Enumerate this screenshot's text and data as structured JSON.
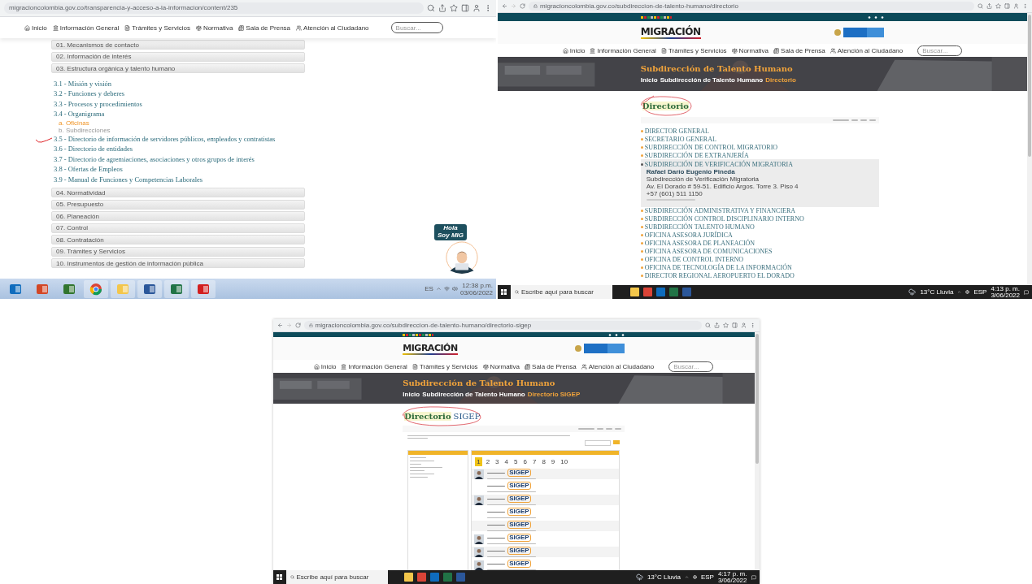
{
  "screenshots": [
    {
      "kind": "transparency",
      "url": "migracioncolombia.gov.co/transparencia-y-acceso-a-la-informacion/content/235",
      "nav": [
        "Inicio",
        "Información General",
        "Trámites y Servicios",
        "Normativa",
        "Sala de Prensa",
        "Atención al Ciudadano"
      ],
      "search_placeholder": "Buscar...",
      "sections_before": [
        "01. Mecanismos de contacto",
        "02. Información de interés",
        "03. Estructura orgánica y talento humano"
      ],
      "links": [
        {
          "label": "3.1 - Misión y visión",
          "marked": false
        },
        {
          "label": "3.2 - Funciones y deberes",
          "marked": false
        },
        {
          "label": "3.3 - Procesos y procedimientos",
          "marked": false
        },
        {
          "label": "3.4 - Organigrama",
          "marked": false,
          "children": [
            {
              "label": "a. Oficinas",
              "selected": true
            },
            {
              "label": "b. Subdirecciones",
              "selected": false
            }
          ]
        },
        {
          "label": "3.5 - Directorio de información de servidores públicos, empleados y contratistas",
          "marked": true
        },
        {
          "label": "3.6 - Directorio de entidades",
          "marked": false
        },
        {
          "label": "3.7 - Directorio de agremiaciones, asociaciones y otros grupos de interés",
          "marked": false
        },
        {
          "label": "3.8 - Ofertas de Empleos",
          "marked": false
        },
        {
          "label": "3.9 - Manual de Funciones y Competencias Laborales",
          "marked": false
        }
      ],
      "sections_after": [
        "04. Normatividad",
        "05. Presupuesto",
        "06. Planeación",
        "07. Control",
        "08. Contratación",
        "09. Trámites y Servicios",
        "10. Instrumentos de gestión de información pública"
      ],
      "assistant": {
        "greeting": "Hola",
        "name": "Soy MIG"
      },
      "taskbar": {
        "language": "ES",
        "time": "12:38 p.m.",
        "date": "03/06/2022"
      }
    },
    {
      "kind": "directory",
      "url": "migracioncolombia.gov.co/subdireccion-de-talento-humano/directorio",
      "logo": "MIGRACIÓN",
      "nav": [
        "Inicio",
        "Información General",
        "Trámites y Servicios",
        "Normativa",
        "Sala de Prensa",
        "Atención al Ciudadano"
      ],
      "search_placeholder": "Buscar...",
      "banner_title": "Subdirección de Talento Humano",
      "breadcrumb": [
        {
          "label": "Inicio",
          "selected": false
        },
        {
          "label": "Subdirección de Talento Humano",
          "selected": false
        },
        {
          "label": "Directorio",
          "selected": true
        }
      ],
      "heading": "Directorio",
      "circled": true,
      "entries": [
        {
          "label": "DIRECTOR GENERAL",
          "expanded": false
        },
        {
          "label": "SECRETARIO GENERAL",
          "expanded": false
        },
        {
          "label": "SUBDIRECCIÓN DE CONTROL MIGRATORIO",
          "expanded": false
        },
        {
          "label": "SUBDIRECCIÓN DE EXTRANJERÍA",
          "expanded": false
        },
        {
          "label": "SUBDIRECCIÓN DE VERIFICACIÓN MIGRATORIA",
          "expanded": true,
          "details": [
            "Rafael Darío Eugenio Pineda",
            "Subdirección de Verificación Migratoria",
            "Av. El Dorado # 59-51. Edificio Argos. Torre 3. Piso 4",
            "+57 (601) 511 1150"
          ]
        },
        {
          "label": "SUBDIRECCIÓN ADMINISTRATIVA Y FINANCIERA",
          "expanded": false
        },
        {
          "label": "SUBDIRECCIÓN CONTROL DISCIPLINARIO INTERNO",
          "expanded": false
        },
        {
          "label": "SUBDIRECCIÓN TALENTO HUMANO",
          "expanded": false
        },
        {
          "label": "OFICINA ASESORA JURÍDICA",
          "expanded": false
        },
        {
          "label": "OFICINA ASESORA DE PLANEACIÓN",
          "expanded": false
        },
        {
          "label": "OFICINA ASESORA DE COMUNICACIONES",
          "expanded": false
        },
        {
          "label": "OFICINA DE CONTROL INTERNO",
          "expanded": false
        },
        {
          "label": "OFICINA DE TECNOLOGÍA DE LA INFORMACIÓN",
          "expanded": false
        },
        {
          "label": "DIRECTOR REGIONAL AEROPUERTO EL DORADO",
          "expanded": false
        }
      ],
      "taskbar": {
        "search_placeholder": "Escribe aquí para buscar",
        "weather": "13°C Lluvia",
        "language": "ESP",
        "time": "4:13 p. m.",
        "date": "3/06/2022"
      }
    },
    {
      "kind": "sigep",
      "url": "migracioncolombia.gov.co/subdireccion-de-talento-humano/directorio-sigep",
      "logo": "MIGRACIÓN",
      "nav": [
        "Inicio",
        "Información General",
        "Trámites y Servicios",
        "Normativa",
        "Sala de Prensa",
        "Atención al Ciudadano"
      ],
      "search_placeholder": "Buscar...",
      "banner_title": "Subdirección de Talento Humano",
      "breadcrumb": [
        {
          "label": "Inicio",
          "selected": false
        },
        {
          "label": "Subdirección de Talento Humano",
          "selected": false
        },
        {
          "label": "Directorio SIGEP",
          "selected": true
        }
      ],
      "heading": "Directorio",
      "heading_suffix": "SIGEP",
      "circled": true,
      "pages": [
        {
          "label": "1",
          "selected": true
        },
        {
          "label": "2",
          "selected": false
        },
        {
          "label": "3",
          "selected": false
        },
        {
          "label": "4",
          "selected": false
        },
        {
          "label": "5",
          "selected": false
        },
        {
          "label": "6",
          "selected": false
        },
        {
          "label": "7",
          "selected": false
        },
        {
          "label": "8",
          "selected": false
        },
        {
          "label": "9",
          "selected": false
        },
        {
          "label": "10",
          "selected": false
        }
      ],
      "people": [
        {
          "photo": true,
          "badge": "SIGEP"
        },
        {
          "photo": false,
          "badge": "SIGEP"
        },
        {
          "photo": true,
          "badge": "SIGEP"
        },
        {
          "photo": false,
          "badge": "SIGEP"
        },
        {
          "photo": false,
          "badge": "SIGEP"
        },
        {
          "photo": true,
          "badge": "SIGEP"
        },
        {
          "photo": true,
          "badge": "SIGEP"
        },
        {
          "photo": true,
          "badge": "SIGEP"
        }
      ],
      "taskbar": {
        "search_placeholder": "Escribe aquí para buscar",
        "weather": "13°C Lluvia",
        "language": "ESP",
        "time": "4:17 p. m.",
        "date": "3/06/2022"
      }
    }
  ]
}
